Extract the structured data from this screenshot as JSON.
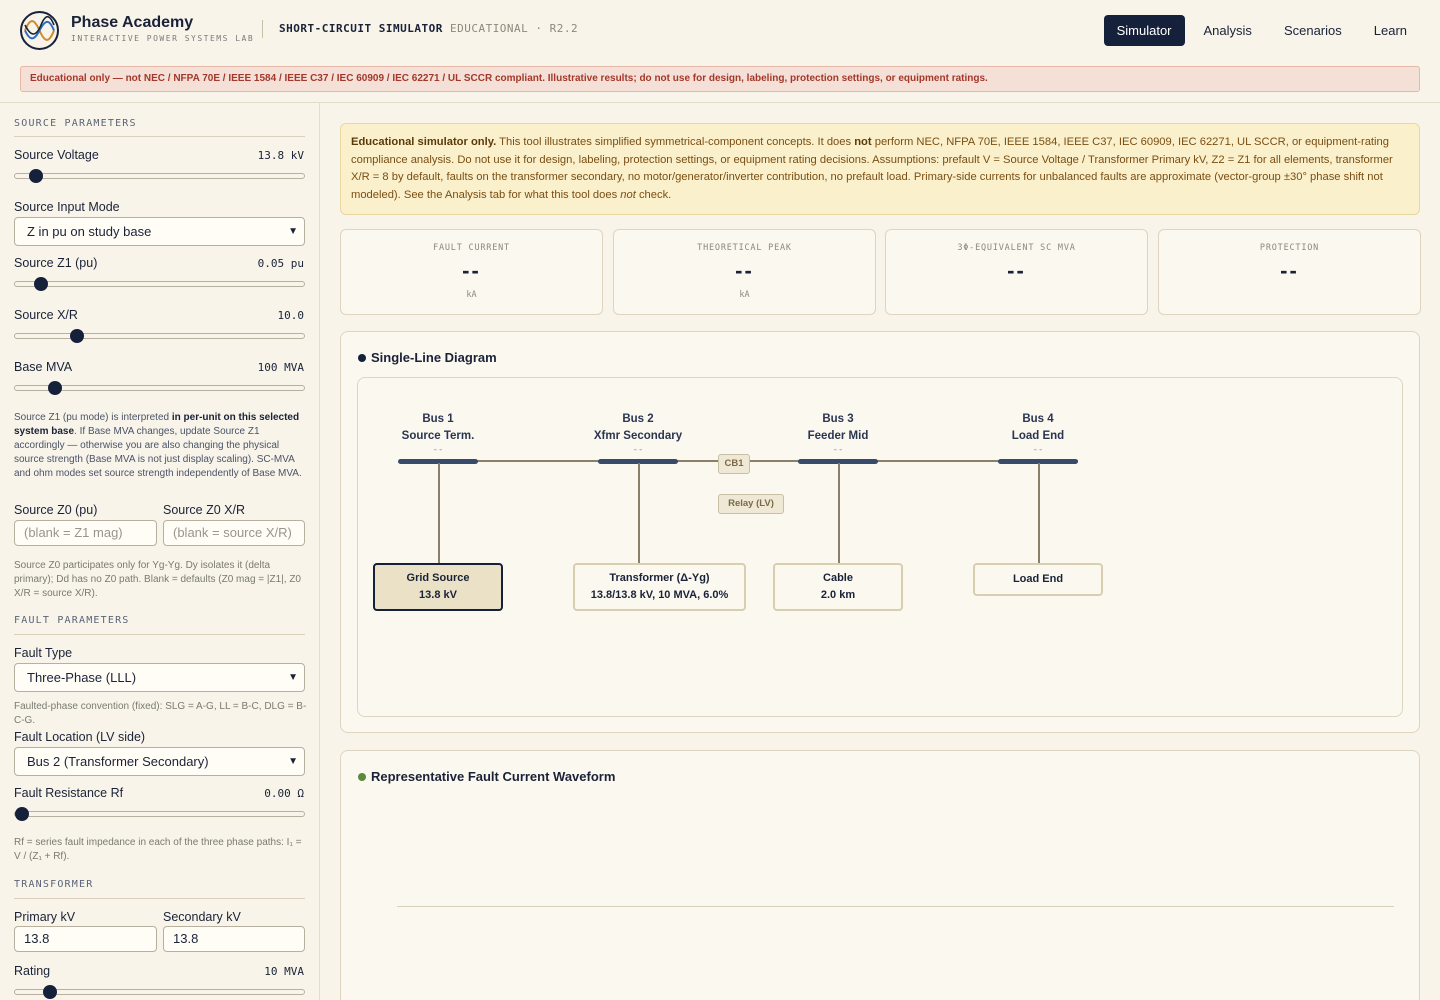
{
  "header": {
    "brand_name": "Phase Academy",
    "brand_sub": "INTERACTIVE POWER SYSTEMS LAB",
    "app_title": "SHORT-CIRCUIT SIMULATOR",
    "app_subtitle": "EDUCATIONAL · R2.2",
    "nav": [
      "Simulator",
      "Analysis",
      "Scenarios",
      "Learn"
    ],
    "active_nav": "Simulator"
  },
  "banner": "Educational only — not NEC / NFPA 70E / IEEE 1584 / IEEE C37 / IEC 60909 / IEC 62271 / UL SCCR compliant. Illustrative results; do not use for design, labeling, protection settings, or equipment ratings.",
  "sidebar": {
    "source_title": "SOURCE PARAMETERS",
    "source_voltage": {
      "label": "Source Voltage",
      "value": "13.8 kV",
      "fraction": 0.05
    },
    "input_mode": {
      "label": "Source Input Mode",
      "selected": "Z in pu on study base"
    },
    "z1": {
      "label": "Source Z1 (pu)",
      "value": "0.05 pu",
      "fraction": 0.07
    },
    "xr": {
      "label": "Source X/R",
      "value": "10.0",
      "fraction": 0.2
    },
    "base_mva": {
      "label": "Base MVA",
      "value": "100 MVA",
      "fraction": 0.12
    },
    "help_pre": "Source Z1 (pu mode) is interpreted ",
    "help_bold": "in per-unit on this selected system base",
    "help_post": ". If Base MVA changes, update Source Z1 accordingly — otherwise you are also changing the physical source strength (Base MVA is not just display scaling). SC-MVA and ohm modes set source strength independently of Base MVA.",
    "z0": {
      "label": "Source Z0 (pu)",
      "placeholder": "(blank = Z1 mag)"
    },
    "z0xr": {
      "label": "Source Z0 X/R",
      "placeholder": "(blank = source X/R)"
    },
    "z0_help": "Source Z0 participates only for Yg-Yg. Dy isolates it (delta primary); Dd has no Z0 path. Blank = defaults (Z0 mag = |Z1|, Z0 X/R = source X/R).",
    "fault_title": "FAULT PARAMETERS",
    "fault_type": {
      "label": "Fault Type",
      "selected": "Three-Phase (LLL)"
    },
    "fault_convention": "Faulted-phase convention (fixed): SLG = A-G, LL = B-C, DLG = B-C-G.",
    "fault_location": {
      "label": "Fault Location (LV side)",
      "selected": "Bus 2 (Transformer Secondary)"
    },
    "rf": {
      "label": "Fault Resistance Rf",
      "value": "0.00 Ω",
      "fraction": 0.0
    },
    "rf_help": "Rf = series fault impedance in each of the three phase paths: I₁ = V / (Z₁ + Rf).",
    "xfmr_title": "TRANSFORMER",
    "primary": {
      "label": "Primary kV",
      "value": "13.8"
    },
    "secondary": {
      "label": "Secondary kV",
      "value": "13.8"
    },
    "rating": {
      "label": "Rating",
      "value": "10 MVA",
      "fraction": 0.1
    }
  },
  "notice": {
    "bold1": "Educational simulator only.",
    "text1": " This tool illustrates simplified symmetrical-component concepts. It does ",
    "bold2": "not",
    "text2": " perform NEC, NFPA 70E, IEEE 1584, IEEE C37, IEC 60909, IEC 62271, UL SCCR, or equipment-rating compliance analysis. Do not use it for design, labeling, protection settings, or equipment rating decisions. Assumptions: prefault V = Source Voltage / Transformer Primary kV, Z2 = Z1 for all elements, transformer X/R = 8 by default, faults on the transformer secondary, no motor/generator/inverter contribution, no prefault load. Primary-side currents for unbalanced faults are approximate (vector-group ±30° phase shift not modeled). See the Analysis tab for what this tool does ",
    "italic": "not",
    "text3": " check."
  },
  "cards": [
    {
      "label": "FAULT CURRENT",
      "value": "--",
      "unit": "kA"
    },
    {
      "label": "THEORETICAL PEAK",
      "value": "--",
      "unit": "kA"
    },
    {
      "label": "3Φ-EQUIVALENT SC MVA",
      "value": "--",
      "unit": ""
    },
    {
      "label": "PROTECTION",
      "value": "--",
      "unit": ""
    }
  ],
  "sld": {
    "title": "Single-Line Diagram",
    "dot_color": "#15203a",
    "buses": [
      {
        "name": "Bus 1",
        "desc": "Source Term.",
        "value": "--"
      },
      {
        "name": "Bus 2",
        "desc": "Xfmr Secondary",
        "value": "--"
      },
      {
        "name": "Bus 3",
        "desc": "Feeder Mid",
        "value": "--"
      },
      {
        "name": "Bus 4",
        "desc": "Load End",
        "value": "--"
      }
    ],
    "equipment": [
      {
        "line1": "Grid Source",
        "line2": "13.8 kV"
      },
      {
        "line1": "Transformer (Δ-Yg)",
        "line2": "13.8/13.8 kV, 10 MVA, 6.0%"
      },
      {
        "line1": "Cable",
        "line2": "2.0 km"
      },
      {
        "line1": "Load End",
        "line2": ""
      }
    ],
    "breaker": "CB1",
    "relay": "Relay (LV)"
  },
  "waveform": {
    "title": "Representative Fault Current Waveform",
    "dot_color": "#5a8a3a"
  }
}
